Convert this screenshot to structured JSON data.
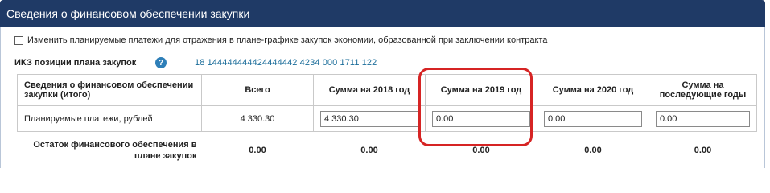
{
  "panel": {
    "title": "Сведения о финансовом обеспечении закупки"
  },
  "checkbox": {
    "label": "Изменить планируемые платежи для отражения в плане-графике закупок экономии, образованной при заключении контракта",
    "checked": false
  },
  "ikz": {
    "label": "ИКЗ позиции плана закупок",
    "help_icon": "?",
    "value": "18 144444444424444442 4234 000 1711 122"
  },
  "table": {
    "headers": [
      "Сведения о финансовом обеспечении закупки (итого)",
      "Всего",
      "Сумма на 2018 год",
      "Сумма на 2019 год",
      "Сумма на 2020 год",
      "Сумма на последующие годы"
    ],
    "payments_row": {
      "label": "Планируемые платежи, рублей",
      "total": "4 330.30",
      "y2018": "4 330.30",
      "y2019": "0.00",
      "y2020": "0.00",
      "later": "0.00"
    },
    "rest_row": {
      "label": "Остаток финансового обеспечения в плане закупок",
      "total": "0.00",
      "y2018": "0.00",
      "y2019": "0.00",
      "y2020": "0.00",
      "later": "0.00"
    }
  },
  "colors": {
    "header_bg": "#1f3a66",
    "highlight": "#d62424",
    "ikz_value": "#1b6d9a",
    "help_icon": "#2e7fb8"
  }
}
